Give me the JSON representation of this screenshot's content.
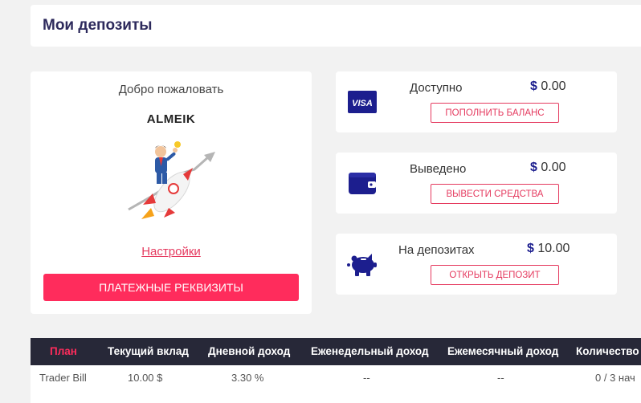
{
  "header": {
    "title": "Мои депозиты"
  },
  "welcome": {
    "greeting": "Добро пожаловать",
    "username": "ALMEIK",
    "settings_link": "Настройки",
    "requisites_button": "ПЛАТЕЖНЫЕ РЕКВИЗИТЫ"
  },
  "stats": [
    {
      "icon": "visa-card-icon",
      "label": "Доступно",
      "currency": "$",
      "amount": "0.00",
      "button": "ПОПОЛНИТЬ БАЛАНС"
    },
    {
      "icon": "wallet-icon",
      "label": "Выведено",
      "currency": "$",
      "amount": "0.00",
      "button": "ВЫВЕСТИ СРЕДСТВА"
    },
    {
      "icon": "piggy-bank-icon",
      "label": "На депозитах",
      "currency": "$",
      "amount": "10.00",
      "button": "ОТКРЫТЬ ДЕПОЗИТ"
    }
  ],
  "visa_text": "VISA",
  "table": {
    "headers": [
      "План",
      "Текущий вклад",
      "Дневной доход",
      "Еженедельный доход",
      "Ежемесячный доход",
      "Количество"
    ],
    "rows": [
      [
        "Trader Bill",
        "10.00 $",
        "3.30 %",
        "--",
        "--",
        "0 / 3 нач"
      ]
    ]
  },
  "colors": {
    "accent": "#ff2c5c",
    "navy": "#1c1e8e",
    "title": "#2d2a5c",
    "table_header": "#272838"
  }
}
